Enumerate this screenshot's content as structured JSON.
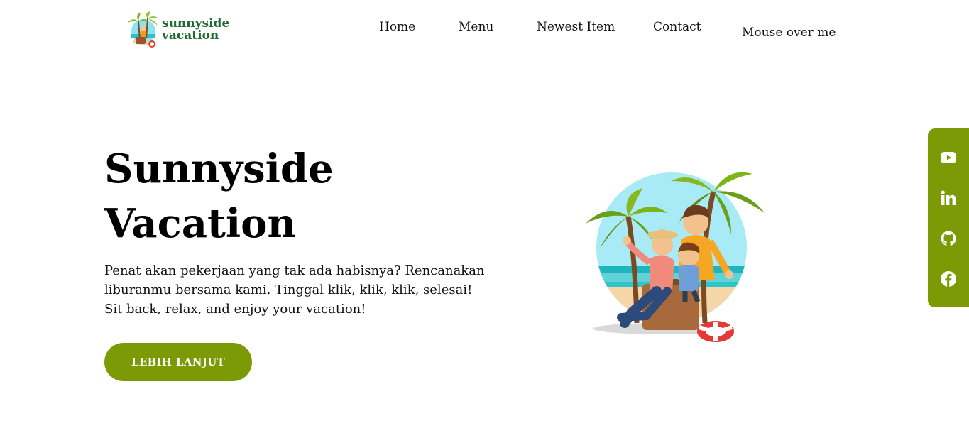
{
  "brand": {
    "line1": "sunnyside",
    "line2": "vacation"
  },
  "nav": {
    "home": "Home",
    "menu": "Menu",
    "newest": "Newest Item",
    "contact": "Contact",
    "mouse_over": "Mouse over me"
  },
  "hero": {
    "title_line1": "Sunnyside",
    "title_line2": "Vacation",
    "description": "Penat akan pekerjaan yang tak ada habisnya? Rencanakan liburanmu bersama kami. Tinggal klik, klik, klik, selesai! Sit back, relax, and enjoy your vacation!",
    "cta_label": "LEBIH LANJUT"
  },
  "social": {
    "icons": [
      "youtube-icon",
      "linkedin-icon",
      "github-icon",
      "facebook-icon"
    ]
  },
  "colors": {
    "accent": "#7b9a06",
    "brand_text": "#1d6b2e"
  }
}
